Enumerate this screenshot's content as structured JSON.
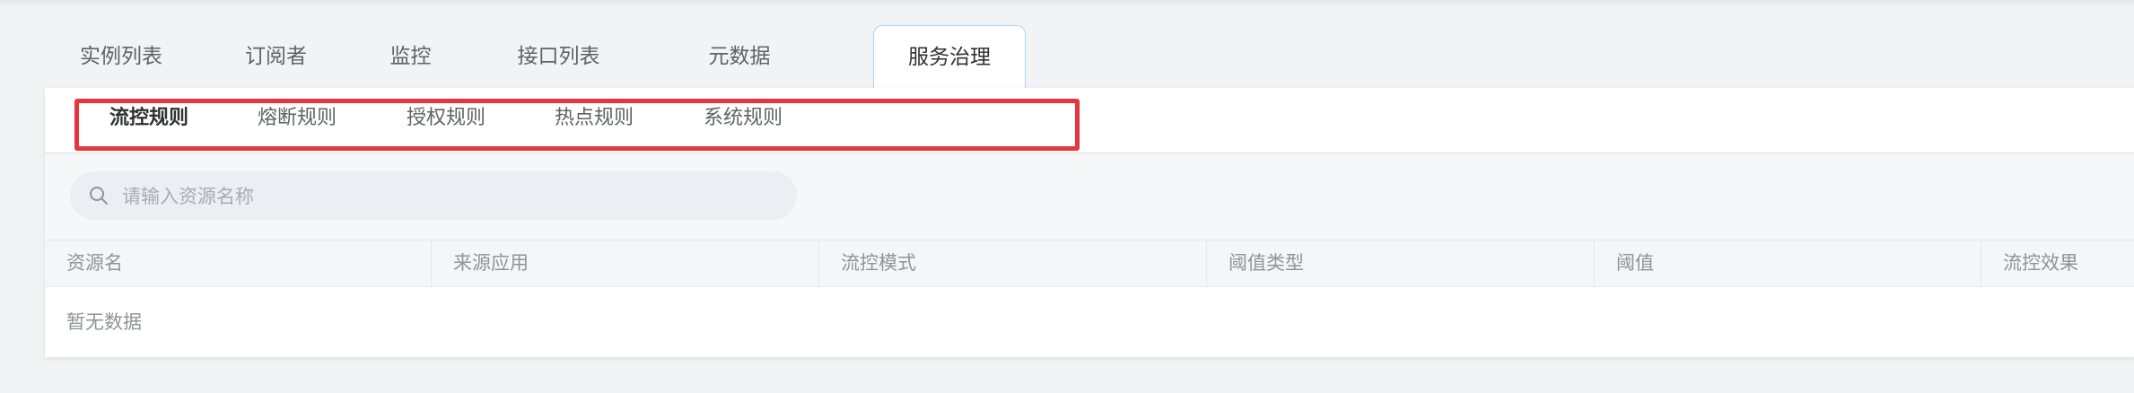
{
  "main_tabs": [
    {
      "label": "实例列表",
      "active": false
    },
    {
      "label": "订阅者",
      "active": false
    },
    {
      "label": "监控",
      "active": false
    },
    {
      "label": "接口列表",
      "active": false
    },
    {
      "label": "元数据",
      "active": false
    },
    {
      "label": "服务治理",
      "active": true
    }
  ],
  "sub_tabs": [
    {
      "label": "流控规则",
      "active": true
    },
    {
      "label": "熔断规则",
      "active": false
    },
    {
      "label": "授权规则",
      "active": false
    },
    {
      "label": "热点规则",
      "active": false
    },
    {
      "label": "系统规则",
      "active": false
    }
  ],
  "search": {
    "placeholder": "请输入资源名称",
    "value": ""
  },
  "table": {
    "columns": [
      "资源名",
      "来源应用",
      "流控模式",
      "阈值类型",
      "阈值",
      "流控效果"
    ],
    "empty_text": "暂无数据"
  },
  "colors": {
    "highlight_border": "#e8343e",
    "active_tab_border": "#a9d4f5",
    "page_background": "#f2f3f5"
  }
}
